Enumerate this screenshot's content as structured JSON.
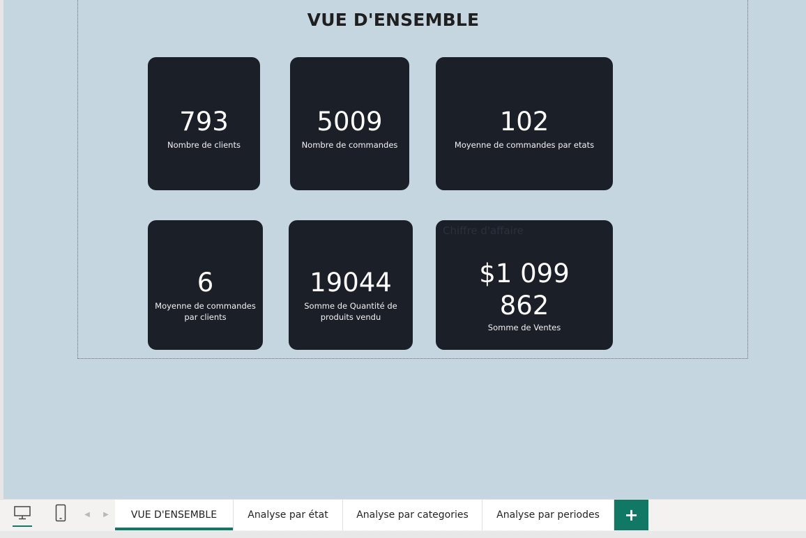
{
  "page": {
    "title": "VUE D'ENSEMBLE"
  },
  "cards": {
    "clients": {
      "value": "793",
      "label": "Nombre de clients"
    },
    "commandes": {
      "value": "5009",
      "label": "Nombre de commandes"
    },
    "moyenne_etats": {
      "value": "102",
      "label": "Moyenne de commandes par etats"
    },
    "moyenne_clients": {
      "value": "6",
      "label_line1": "Moyenne de commandes",
      "label_line2": "par clients"
    },
    "quantite": {
      "value": "19044",
      "label_line1": "Somme de Quantité de",
      "label_line2": "produits vendu"
    },
    "ventes": {
      "title": "Chiffre d'affaire",
      "value_line1": "$1 099",
      "value_line2": "862",
      "label": "Somme de Ventes"
    }
  },
  "tabs": [
    {
      "label": "VUE D'ENSEMBLE",
      "active": true
    },
    {
      "label": "Analyse par état",
      "active": false
    },
    {
      "label": "Analyse par categories",
      "active": false
    },
    {
      "label": "Analyse par periodes",
      "active": false
    }
  ],
  "add_page": {
    "label": "+"
  },
  "icons": {
    "desktop": "desktop-icon",
    "phone": "phone-icon",
    "prev": "chevron-left-icon",
    "next": "chevron-right-icon"
  },
  "colors": {
    "canvas": "#c5d6e0",
    "card": "#1b2028",
    "accent": "#117865"
  }
}
